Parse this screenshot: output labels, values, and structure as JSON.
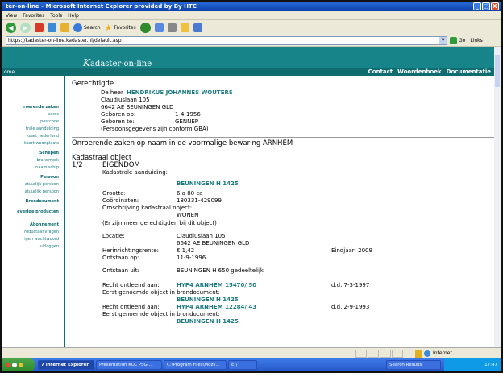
{
  "window": {
    "title": "ter-on-line - Microsoft Internet Explorer provided by By HTC",
    "min": "_",
    "max": "□",
    "close": "X"
  },
  "menu": [
    "View",
    "Favorites",
    "Tools",
    "Help"
  ],
  "toolbar": {
    "search": "Search",
    "favorites": "Favorites"
  },
  "address": {
    "url": "https://kadaster-on-line.kadaster.nl/default.asp",
    "go": "Go",
    "links": "Links"
  },
  "site": {
    "logo_initial": "K",
    "logo_rest": "adaster-on-line",
    "home": "ome",
    "nav": [
      "Contact",
      "Woordenboek",
      "Documentatie"
    ]
  },
  "sidebar": [
    {
      "label": "roerende zaken",
      "bold": true
    },
    {
      "label": "adres"
    },
    {
      "label": "postcode"
    },
    {
      "label": "trale aanduiding"
    },
    {
      "label": "kaart nederland"
    },
    {
      "label": "kaart woonplaats"
    },
    {
      "label": "Schepen",
      "bold": true
    },
    {
      "label": "brandmerk"
    },
    {
      "label": "naam schip"
    },
    {
      "label": "Persoon",
      "bold": true
    },
    {
      "label": "atuurlijk persoon"
    },
    {
      "label": "atuurlijk persoon"
    },
    {
      "label": "Brondocument",
      "bold": true
    },
    {
      "label": "everige producten",
      "bold": true
    },
    {
      "label": "Abonnement",
      "bold": true
    },
    {
      "label": "roductaanvragen"
    },
    {
      "label": "rigen wachtwoord"
    },
    {
      "label": "uitloggen"
    }
  ],
  "content": {
    "gerechtigde_heading": "Gerechtigde",
    "person_prefix": "De heer",
    "person_name": "HENDRIKUS JOHANNES WOUTERS",
    "street": "Claudiuslaan 105",
    "city": "6642 AE  BEUNINGEN GLD",
    "born_on_label": "Geboren op:",
    "born_on": "1-4-1956",
    "born_in_label": "Geboren te:",
    "born_in": "GENNEP",
    "gba_note": "(Persoonsgegevens zijn conform GBA)",
    "section2": "Onroerende zaken op naam in de voormalige bewaring ARNHEM",
    "object_heading": "Kadastraal object",
    "object_index": "1/2",
    "object_type": "EIGENDOM",
    "kad_label": "Kadastrale aanduiding:",
    "kad_value": "BEUNINGEN H 1425",
    "size_label": "Grootte:",
    "size_value": "6 a 80 ca",
    "coords_label": "Coördinaten:",
    "coords_value": "180331-429099",
    "omschr_label": "Omschrijving kadastraal object:",
    "omschr_value": "WONEN",
    "more_note": "(Er zijn meer gerechtigden bij dit object)",
    "loc_label": "Locatie:",
    "loc_street": "Claudiuslaan 105",
    "loc_city": "6642 AE  BEUNINGEN GLD",
    "herinn_label": "Herinrichtingsrente:",
    "herinn_value": "€ 1,42",
    "eindjaar": "Eindjaar: 2009",
    "ontstaan_op_label": "Ontstaan op:",
    "ontstaan_op": "11-9-1996",
    "ontstaan_uit_label": "Ontstaan uit:",
    "ontstaan_uit": "BEUNINGEN H 650 gedeeltelijk",
    "recht1_label": "Recht ontleend aan:",
    "recht1_doc": "HYP4 ARNHEM 15470/ 50",
    "recht1_date": "d.d. 7-3-1997",
    "eerst1": "Eerst genoemde object in brondocument:",
    "eerst1_obj": "BEUNINGEN H 1425",
    "recht2_label": "Recht ontleend aan:",
    "recht2_doc": "HYP4 ARNHEM 12284/ 43",
    "recht2_date": "d.d. 2-9-1993",
    "eerst2": "Eerst genoemde object in brondocument:",
    "eerst2_obj": "BEUNINGEN H 1425"
  },
  "status": {
    "zone": "Internet"
  },
  "taskbar": {
    "start": "",
    "tasks": [
      "7 Internet Explorer",
      "Presentation KOL PSG ...",
      "C:\\Program Files\\Mozil...",
      "E:\\",
      "Search Results"
    ],
    "tray_lang": "",
    "clock": "17:47"
  },
  "colors": {
    "site_teal": "#17848a",
    "link_teal": "#1a7a80",
    "xp_blue": "#2557c8"
  }
}
